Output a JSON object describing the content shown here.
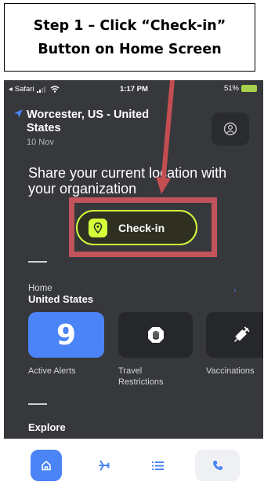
{
  "step": {
    "line1": "Step 1 – Click “Check-in”",
    "line2": "Button on Home Screen"
  },
  "status_bar": {
    "carrier": "Safari",
    "time": "1:17 PM",
    "battery": "51%"
  },
  "location": {
    "name": "Worcester, US - United States",
    "date": "10 Nov"
  },
  "share_prompt": "Share your current location with your organization",
  "checkin_button": {
    "label": "Check-in"
  },
  "home": {
    "label": "Home",
    "country": "United States"
  },
  "tiles": [
    {
      "value": "9",
      "label": "Active Alerts",
      "icon": ""
    },
    {
      "value": "",
      "label": "Travel Restrictions",
      "icon": "hand-stop-icon"
    },
    {
      "value": "",
      "label": "Vaccinations",
      "icon": "syringe-icon"
    }
  ],
  "explore_label": "Explore",
  "tabs": [
    {
      "name": "home",
      "icon": "home-icon",
      "active": true
    },
    {
      "name": "travel",
      "icon": "airplane-icon",
      "active": false
    },
    {
      "name": "list",
      "icon": "list-icon",
      "active": false
    },
    {
      "name": "call",
      "icon": "phone-icon",
      "active": false
    }
  ],
  "colors": {
    "accent_blue": "#4a84f6",
    "checkin_green": "#d4ff39",
    "highlight_red": "#c1545a",
    "arrow_red": "#c34e52",
    "app_background": "#36383c"
  }
}
